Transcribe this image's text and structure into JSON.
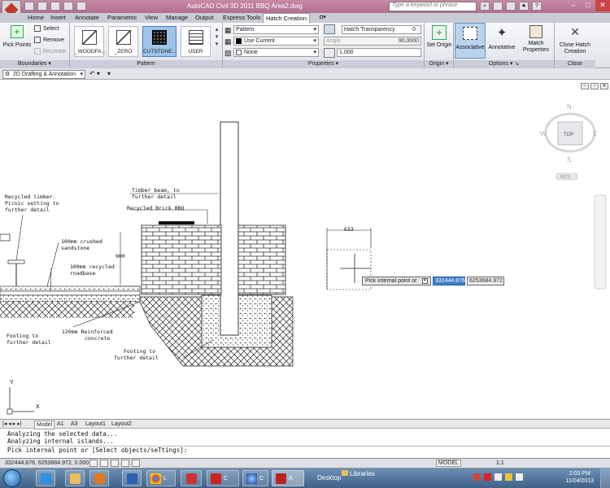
{
  "window": {
    "title": "AutoCAD Civil 3D 2011   BBQ Area2.dwg",
    "search_placeholder": "Type a keyword or phrase"
  },
  "ribbon_tabs": [
    "Home",
    "Insert",
    "Annotate",
    "Parametric",
    "View",
    "Manage",
    "Output",
    "Express Tools",
    "Hatch Creation"
  ],
  "active_tab": "Hatch Creation",
  "boundaries": {
    "pick_points": "Pick Points",
    "select": "Select",
    "remove": "Remove",
    "recreate": "Recreate",
    "title": "Boundaries"
  },
  "pattern": {
    "swatches": [
      "_WOODFA...",
      "_ZERO",
      "CUTSTONE...",
      "USER"
    ],
    "selected": "CUTSTONE...",
    "title": "Pattern"
  },
  "properties": {
    "type": "Pattern",
    "color": "Use Current",
    "background": "None",
    "transparency_label": "Hatch Transparency",
    "transparency_value": "0",
    "angle_label": "Angle",
    "angle_value": "90,0000",
    "scale_value": "1,000",
    "title": "Properties"
  },
  "origin": {
    "set_origin": "Set Origin",
    "title": "Origin"
  },
  "options": {
    "associative": "Associative",
    "annotative": "Annotative",
    "match": "Match Properties",
    "title": "Options"
  },
  "close": {
    "label": "Close Hatch Creation",
    "title": "Close"
  },
  "workspace": "2D Drafting & Annotation",
  "viewcube": {
    "n": "N",
    "s": "S",
    "e": "E",
    "w": "W",
    "face": "TOP",
    "ucs": "WCS"
  },
  "drawing_labels": {
    "recycled_timber": [
      "Recycled timber.",
      "Picnic setting to",
      "further detail"
    ],
    "timber_beam": [
      "Timber beam, to",
      "further detail"
    ],
    "recycled_brick": "Recycled Brick BBQ",
    "crushed": [
      "100mm crushed",
      "sandstone"
    ],
    "roadbase": [
      "100mm recycled",
      "roadbase"
    ],
    "dim_900": "900",
    "reinforced": [
      "120mm Reinforced",
      "concrete"
    ],
    "footing_left": [
      "Footing to",
      "further detail"
    ],
    "footing_right": [
      "Footing to",
      "further detail"
    ],
    "dim_633": "633",
    "axis_y": "Y",
    "axis_x": "X"
  },
  "cursor_prompt": {
    "label": "Pick internal point or",
    "x_value": "332444.876",
    "y_value": "6253684.972"
  },
  "layout_tabs": [
    "Model",
    "A1",
    "A3",
    "Layout1",
    "Layout2"
  ],
  "command_history": [
    "Analyzing the selected data...",
    "Analyzing internal islands...",
    ""
  ],
  "command_prompt": "Pick internal point or [Select objects/seTtings]:",
  "status": {
    "coordinates": "332444.876, 6253684.972, 0.000",
    "model": "MODEL",
    "scale": "1:1"
  },
  "taskbar": {
    "items": [
      "L",
      "C",
      "C",
      "A"
    ],
    "desktop": "Desktop",
    "libraries": "Libraries",
    "time": "2:03 PM",
    "date": "11/04/2013"
  }
}
